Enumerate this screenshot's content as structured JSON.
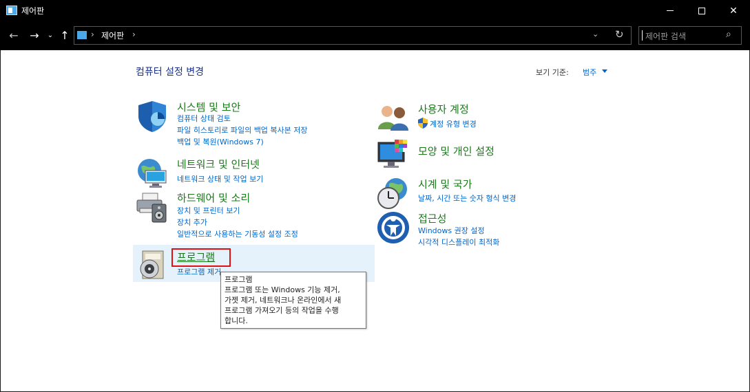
{
  "window": {
    "title": "제어판",
    "minimize_icon": "minimize-icon",
    "maximize_icon": "maximize-icon",
    "close_symbol": "✕"
  },
  "nav": {
    "back_symbol": "←",
    "forward_symbol": "→",
    "recent_symbol": "⌄",
    "up_symbol": "↑"
  },
  "address": {
    "separator": "›",
    "crumb": "제어판",
    "dropdown_symbol": "⌄",
    "refresh_symbol": "↻"
  },
  "search": {
    "placeholder": "제어판 검색",
    "icon_symbol": "⌕"
  },
  "content": {
    "heading": "컴퓨터 설정 변경",
    "view_by_label": "보기 기준:",
    "view_by_value": "범주"
  },
  "categories_left": [
    {
      "title": "시스템 및 보안",
      "icon": "shield-icon",
      "links": [
        "컴퓨터 상태 검토",
        "파일 히스토리로 파일의 백업 복사본 저장",
        "백업 및 복원(Windows 7)"
      ]
    },
    {
      "title": "네트워크 및 인터넷",
      "icon": "network-globe-icon",
      "links": [
        "네트워크 상태 및 작업 보기"
      ]
    },
    {
      "title": "하드웨어 및 소리",
      "icon": "printer-speaker-icon",
      "links": [
        "장치 및 프린터 보기",
        "장치 추가",
        "일반적으로 사용하는 기동성 설정 조정"
      ]
    },
    {
      "title": "프로그램",
      "icon": "programs-disc-icon",
      "links": [
        "프로그램 제거"
      ]
    }
  ],
  "categories_right": [
    {
      "title": "사용자 계정",
      "icon": "user-accounts-icon",
      "links": [
        "계정 유형 변경"
      ]
    },
    {
      "title": "모양 및 개인 설정",
      "icon": "monitor-palette-icon",
      "links": []
    },
    {
      "title": "시계 및 국가",
      "icon": "clock-globe-icon",
      "links": [
        "날짜, 시간 또는 숫자 형식 변경"
      ]
    },
    {
      "title": "접근성",
      "icon": "accessibility-icon",
      "links": [
        "Windows 권장 설정",
        "시각적 디스플레이 최적화"
      ]
    }
  ],
  "tooltip": {
    "lines": [
      "프로그램",
      "프로그램 또는 Windows 기능 제거,",
      "가젯 제거, 네트워크나 온라인에서 새",
      "프로그램 가져오기 등의 작업을 수행",
      "합니다."
    ]
  },
  "colors": {
    "category_title": "#1a7a1a",
    "link": "#0066cc",
    "heading": "#1e3287",
    "hover": "#e5f1fb",
    "focus": "#e01010"
  }
}
